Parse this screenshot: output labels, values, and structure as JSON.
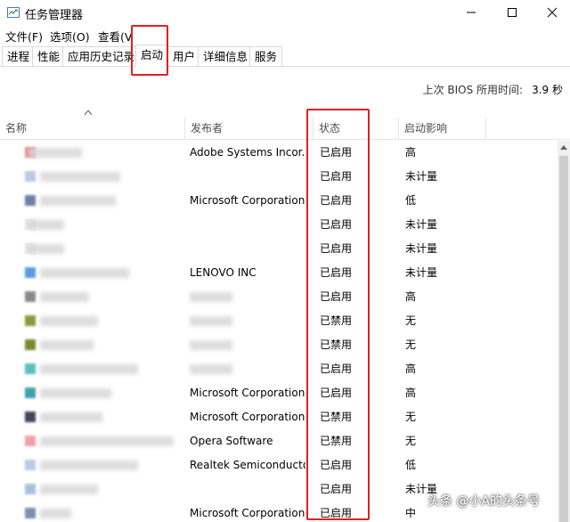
{
  "window": {
    "title": "任务管理器"
  },
  "menu": [
    {
      "label": "文件(F)"
    },
    {
      "label": "选项(O)"
    },
    {
      "label": "查看(V)"
    }
  ],
  "tabs": [
    {
      "label": "进程"
    },
    {
      "label": "性能"
    },
    {
      "label": "应用历史记录"
    },
    {
      "label": "启动",
      "active": true
    },
    {
      "label": "用户"
    },
    {
      "label": "详细信息"
    },
    {
      "label": "服务"
    }
  ],
  "bios": {
    "label": "上次 BIOS 所用时间:",
    "value": "3.9 秒"
  },
  "columns": {
    "name": "名称",
    "publisher": "发布者",
    "status": "状态",
    "impact": "启动影响"
  },
  "rows": [
    {
      "publisher": "Adobe Systems Incor...",
      "status": "已启用",
      "impact": "高",
      "icon_color": "#e58a8a"
    },
    {
      "publisher": "",
      "status": "已启用",
      "impact": "未计量",
      "icon_color": "#b9cbe6"
    },
    {
      "publisher": "Microsoft Corporation",
      "status": "已启用",
      "impact": "低",
      "icon_color": "#6f7fa8"
    },
    {
      "publisher": "",
      "status": "已启用",
      "impact": "未计量",
      "icon_color": "#e4e4e4"
    },
    {
      "publisher": "",
      "status": "已启用",
      "impact": "未计量",
      "icon_color": "#e4e4e4"
    },
    {
      "publisher": "LENOVO INC",
      "status": "已启用",
      "impact": "未计量",
      "icon_color": "#5b9be0"
    },
    {
      "publisher": "",
      "status": "已启用",
      "impact": "高",
      "icon_color": "#8a8a8a"
    },
    {
      "publisher": "",
      "status": "已禁用",
      "impact": "无",
      "icon_color": "#8a9a3a"
    },
    {
      "publisher": "",
      "status": "已禁用",
      "impact": "无",
      "icon_color": "#7a8a2a"
    },
    {
      "publisher": "",
      "status": "已启用",
      "impact": "高",
      "icon_color": "#5ac0c0"
    },
    {
      "publisher": "Microsoft Corporation",
      "status": "已启用",
      "impact": "高",
      "icon_color": "#40a0b0"
    },
    {
      "publisher": "Microsoft Corporation",
      "status": "已禁用",
      "impact": "无",
      "icon_color": "#404858"
    },
    {
      "publisher": "Opera Software",
      "status": "已禁用",
      "impact": "无",
      "icon_color": "#f0a0a8"
    },
    {
      "publisher": "Realtek Semiconductor",
      "status": "已启用",
      "impact": "低",
      "icon_color": "#b9cbe6"
    },
    {
      "publisher": "",
      "status": "已启用",
      "impact": "未计量",
      "icon_color": "#a8c0e0"
    },
    {
      "publisher": "Microsoft Corporation",
      "status": "已启用",
      "impact": "中",
      "icon_color": "#7a90b0"
    }
  ],
  "watermark": "头条 @小A的头条号",
  "highlight_color": "#e02020"
}
